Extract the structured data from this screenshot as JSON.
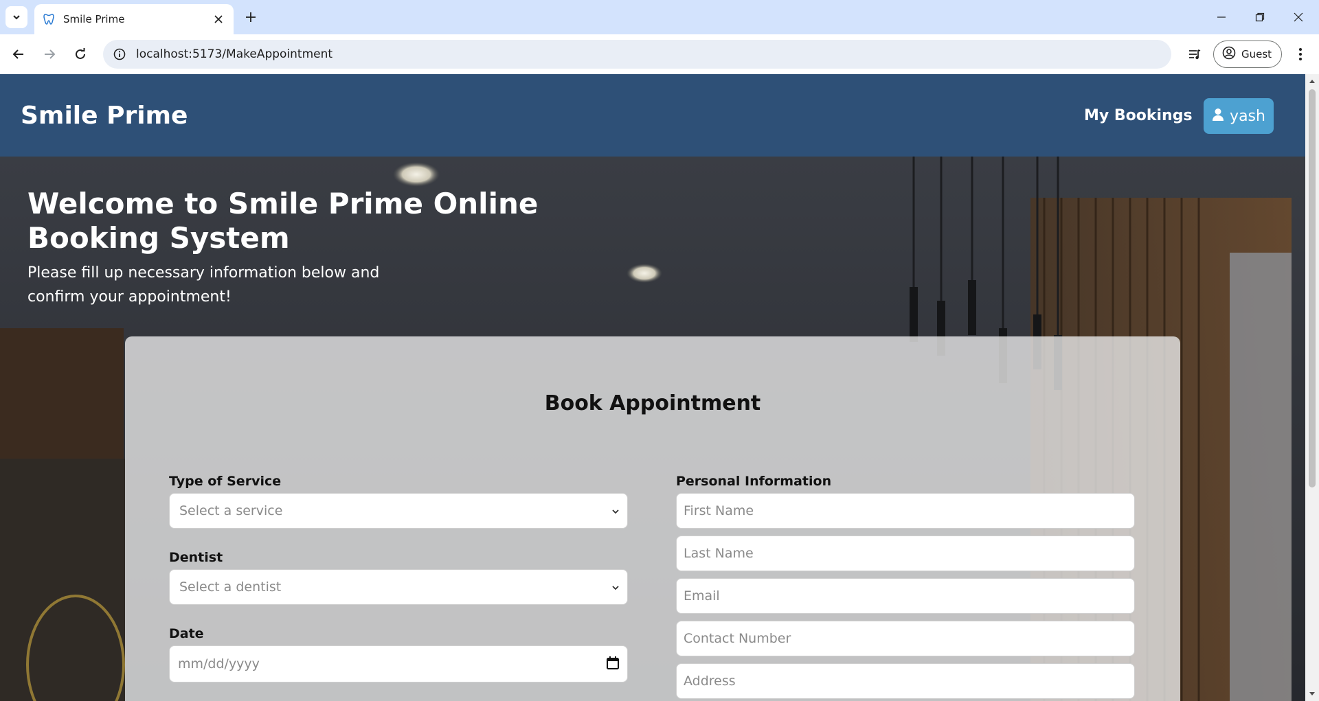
{
  "browser": {
    "tab_title": "Smile Prime",
    "url": "localhost:5173/MakeAppointment",
    "profile_label": "Guest",
    "icons": [
      "tab-list-icon",
      "tooth-favicon-icon",
      "close-icon",
      "plus-icon",
      "minimize-icon",
      "restore-icon",
      "window-close-icon",
      "back-icon",
      "forward-icon",
      "reload-icon",
      "site-info-icon",
      "media-controls-icon",
      "profile-icon",
      "more-menu-icon"
    ]
  },
  "header": {
    "brand": "Smile Prime",
    "nav_bookings": "My Bookings",
    "user_name": "yash",
    "colors": {
      "header_bg": "#2e5077",
      "user_button_bg": "#4da1d1"
    }
  },
  "hero": {
    "title": "Welcome to Smile Prime Online Booking System",
    "subtitle": "Please fill up necessary information below and confirm your appointment!"
  },
  "form": {
    "title": "Book Appointment",
    "service": {
      "label": "Type of Service",
      "placeholder": "Select a service"
    },
    "dentist": {
      "label": "Dentist",
      "placeholder": "Select a dentist"
    },
    "date": {
      "label": "Date",
      "placeholder": "mm/dd/yyyy"
    },
    "personal": {
      "label": "Personal Information",
      "first_name": "First Name",
      "last_name": "Last Name",
      "email": "Email",
      "contact": "Contact Number",
      "address": "Address"
    }
  }
}
